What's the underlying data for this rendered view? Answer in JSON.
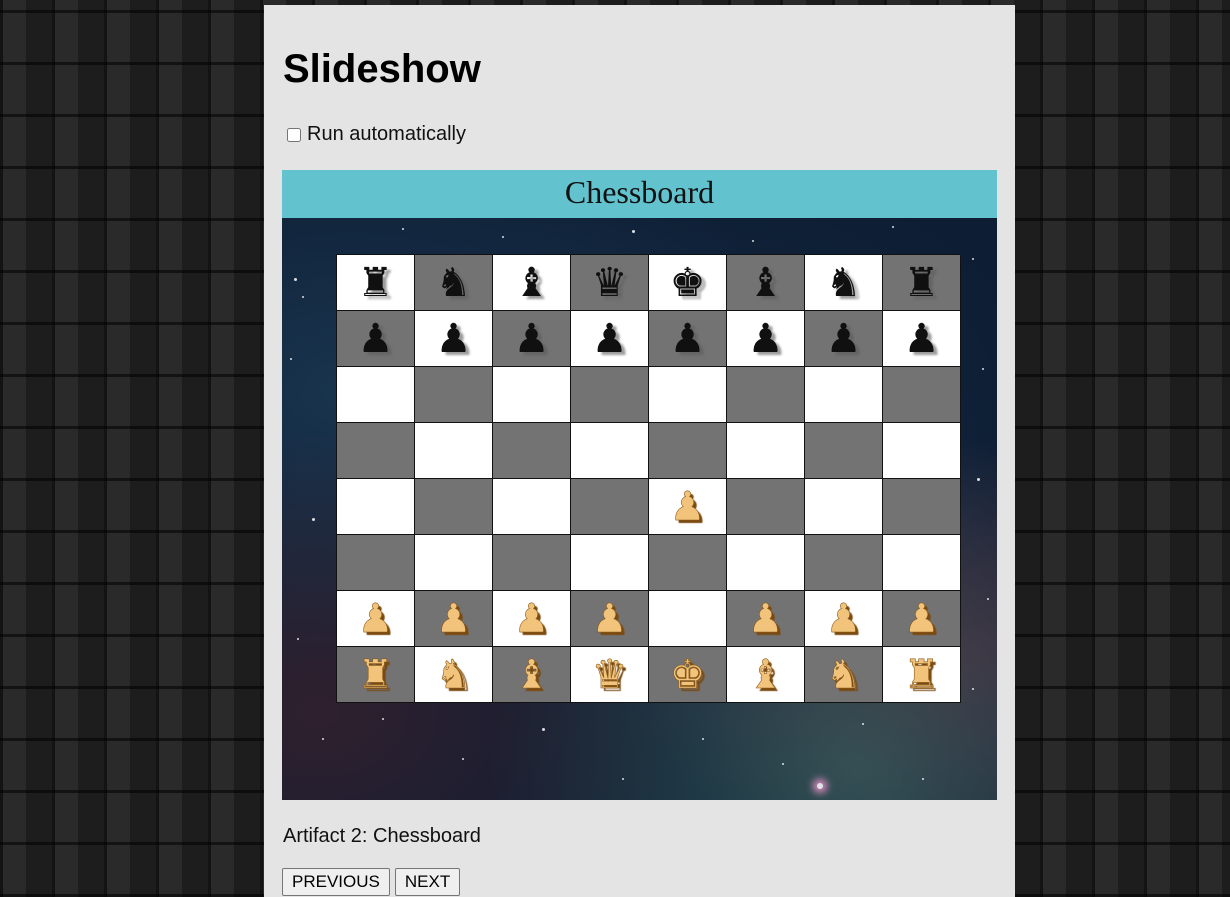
{
  "page": {
    "title": "Slideshow",
    "auto_label": "Run automatically",
    "auto_checked": false
  },
  "slide": {
    "header": "Chessboard",
    "caption": "Artifact 2: Chessboard"
  },
  "board": {
    "light_color": "#ffffff",
    "dark_color": "#737373",
    "pieces": [
      [
        {
          "c": "black",
          "p": "rook",
          "g": "♜"
        },
        {
          "c": "black",
          "p": "knight",
          "g": "♞"
        },
        {
          "c": "black",
          "p": "bishop",
          "g": "♝"
        },
        {
          "c": "black",
          "p": "queen",
          "g": "♛"
        },
        {
          "c": "black",
          "p": "king",
          "g": "♚"
        },
        {
          "c": "black",
          "p": "bishop",
          "g": "♝"
        },
        {
          "c": "black",
          "p": "knight",
          "g": "♞"
        },
        {
          "c": "black",
          "p": "rook",
          "g": "♜"
        }
      ],
      [
        {
          "c": "black",
          "p": "pawn",
          "g": "♟"
        },
        {
          "c": "black",
          "p": "pawn",
          "g": "♟"
        },
        {
          "c": "black",
          "p": "pawn",
          "g": "♟"
        },
        {
          "c": "black",
          "p": "pawn",
          "g": "♟"
        },
        {
          "c": "black",
          "p": "pawn",
          "g": "♟"
        },
        {
          "c": "black",
          "p": "pawn",
          "g": "♟"
        },
        {
          "c": "black",
          "p": "pawn",
          "g": "♟"
        },
        {
          "c": "black",
          "p": "pawn",
          "g": "♟"
        }
      ],
      [
        null,
        null,
        null,
        null,
        null,
        null,
        null,
        null
      ],
      [
        null,
        null,
        null,
        null,
        null,
        null,
        null,
        null
      ],
      [
        null,
        null,
        null,
        null,
        {
          "c": "white",
          "p": "pawn",
          "g": "♟"
        },
        null,
        null,
        null
      ],
      [
        null,
        null,
        null,
        null,
        null,
        null,
        null,
        null
      ],
      [
        {
          "c": "white",
          "p": "pawn",
          "g": "♟"
        },
        {
          "c": "white",
          "p": "pawn",
          "g": "♟"
        },
        {
          "c": "white",
          "p": "pawn",
          "g": "♟"
        },
        {
          "c": "white",
          "p": "pawn",
          "g": "♟"
        },
        null,
        {
          "c": "white",
          "p": "pawn",
          "g": "♟"
        },
        {
          "c": "white",
          "p": "pawn",
          "g": "♟"
        },
        {
          "c": "white",
          "p": "pawn",
          "g": "♟"
        }
      ],
      [
        {
          "c": "white",
          "p": "rook",
          "g": "♜"
        },
        {
          "c": "white",
          "p": "knight",
          "g": "♞"
        },
        {
          "c": "white",
          "p": "bishop",
          "g": "♝"
        },
        {
          "c": "white",
          "p": "queen",
          "g": "♛"
        },
        {
          "c": "white",
          "p": "king",
          "g": "♚"
        },
        {
          "c": "white",
          "p": "bishop",
          "g": "♝"
        },
        {
          "c": "white",
          "p": "knight",
          "g": "♞"
        },
        {
          "c": "white",
          "p": "rook",
          "g": "♜"
        }
      ]
    ]
  },
  "nav": {
    "prev_label": "PREVIOUS",
    "next_label": "NEXT"
  }
}
